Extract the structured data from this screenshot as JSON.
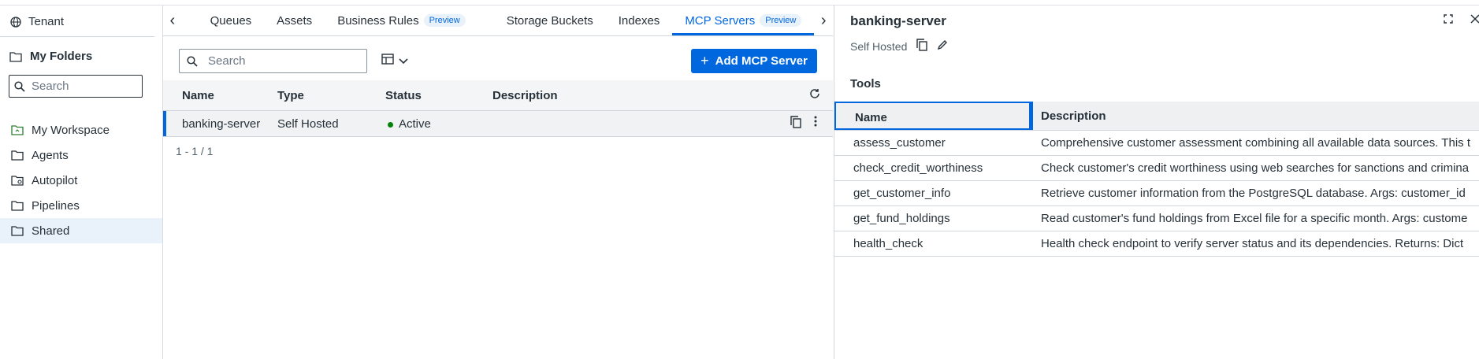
{
  "left_panel": {
    "tenant_label": "Tenant",
    "my_folders_label": "My Folders",
    "search_placeholder": "Search",
    "folders": [
      {
        "label": "My Workspace",
        "icon": "workspace-folder-icon"
      },
      {
        "label": "Agents",
        "icon": "folder-icon"
      },
      {
        "label": "Autopilot",
        "icon": "autopilot-folder-icon"
      },
      {
        "label": "Pipelines",
        "icon": "folder-icon"
      },
      {
        "label": "Shared",
        "icon": "folder-icon",
        "selected": true
      }
    ]
  },
  "tabs": [
    {
      "label": "Queues"
    },
    {
      "label": "Assets"
    },
    {
      "label": "Business Rules",
      "badge": "Preview"
    },
    {
      "label": "Storage Buckets"
    },
    {
      "label": "Indexes"
    },
    {
      "label": "MCP Servers",
      "badge": "Preview",
      "active": true
    }
  ],
  "toolbar": {
    "search_placeholder": "Search",
    "add_button_label": "Add MCP Server"
  },
  "grid": {
    "columns": [
      "Name",
      "Type",
      "Status",
      "Description"
    ],
    "rows": [
      {
        "name": "banking-server",
        "type": "Self Hosted",
        "status": "Active",
        "description": ""
      }
    ],
    "pager": "1 - 1 / 1"
  },
  "detail": {
    "title": "banking-server",
    "subtitle": "Self Hosted",
    "tools_label": "Tools",
    "tools_columns": [
      "Name",
      "Description"
    ],
    "tools": [
      {
        "name": "assess_customer",
        "description": "Comprehensive customer assessment combining all available data sources. This t"
      },
      {
        "name": "check_credit_worthiness",
        "description": "Check customer's credit worthiness using web searches for sanctions and crimina"
      },
      {
        "name": "get_customer_info",
        "description": "Retrieve customer information from the PostgreSQL database. Args: customer_id"
      },
      {
        "name": "get_fund_holdings",
        "description": "Read customer's fund holdings from Excel file for a specific month. Args: custome"
      },
      {
        "name": "health_check",
        "description": "Health check endpoint to verify server status and its dependencies. Returns: Dict"
      }
    ]
  },
  "colors": {
    "accent": "#0067df",
    "status_active": "#038108",
    "selected_folder_bg": "#e9f1fa"
  }
}
